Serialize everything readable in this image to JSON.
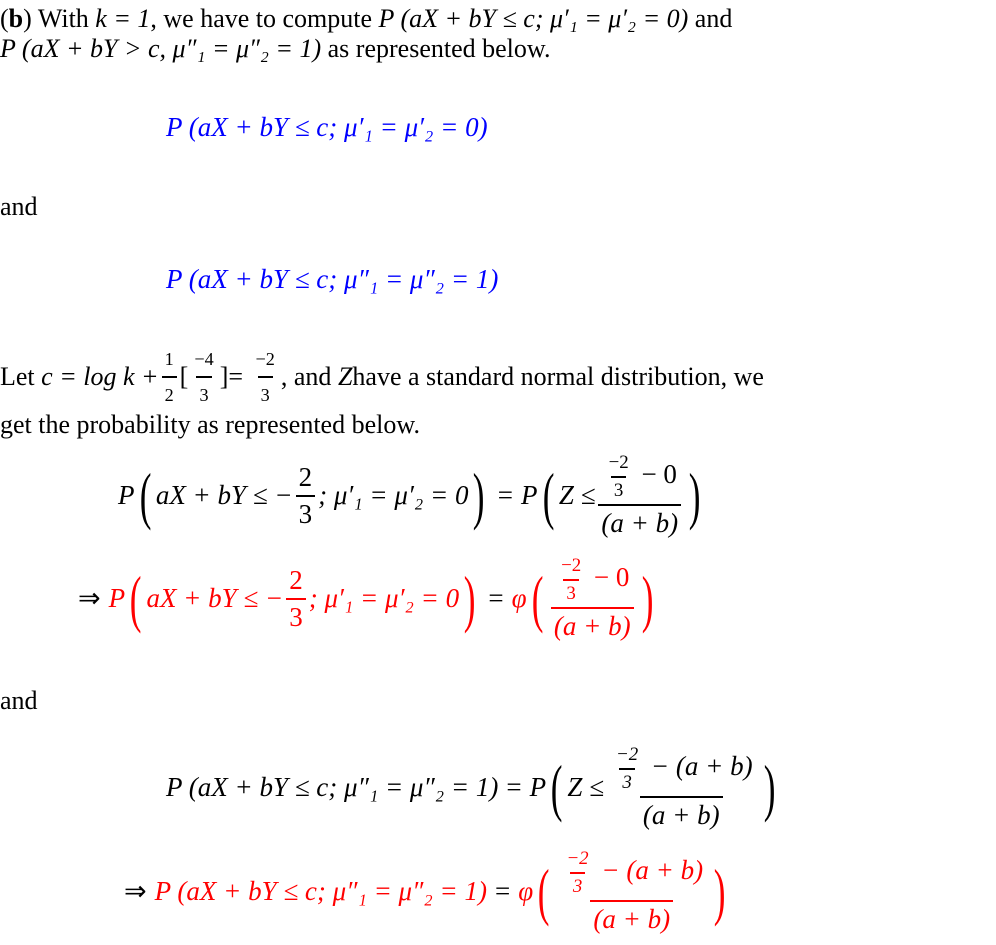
{
  "part_label": "b",
  "intro": {
    "line1_prefix": "With ",
    "k_eq": "k = 1",
    "line1_mid": ", we have to compute ",
    "expr1": "P (aX + bY ≤ c; μ′₁ = μ′₂ = 0)",
    "line1_suffix": " and",
    "expr2": "P (aX + bY > c, μ″₁ = μ″₂ = 1)",
    "line2_suffix": " as represented below."
  },
  "display1": {
    "text": "P (aX + bY ≤ c; μ′₁ = μ′₂ = 0)",
    "color": "#0000ff"
  },
  "and_1": "and",
  "display2": {
    "text": "P (aX + bY ≤ c; μ″₁ = μ″₂ = 1)",
    "color": "#0000ff"
  },
  "let_para": {
    "prefix": "Let ",
    "c_def": "c = log k + ",
    "half_num": "1",
    "half_den": "2",
    "bracket_num": "−4",
    "bracket_den": "3",
    "eq": " = ",
    "res_num": "−2",
    "res_den": "3",
    "suffix1": ", and ",
    "Z": "Z",
    "suffix2": " have a standard normal distribution, we",
    "line2": "get the probability as represented below."
  },
  "eq_block1": {
    "line1_lhs": "P",
    "line1_inner_a": "aX + bY ≤ −",
    "frac_num": "2",
    "frac_den": "3",
    "line1_inner_b": "; μ′₁ = μ′₂ = 0",
    "equals": "=",
    "rhs_P": "P",
    "rhs_Z": "Z ≤",
    "rhs_small_num": "−2",
    "rhs_small_den": "3",
    "rhs_num_rest": " − 0",
    "rhs_den": "(a + b)",
    "line2_arrow": "⇒",
    "line2_lhs": "P",
    "line2_phi": "φ",
    "color": "#ff0000"
  },
  "and_2": "and",
  "eq_block2": {
    "line1_lhs": "P (aX + bY ≤ c; μ″₁ = μ″₂ = 1)",
    "equals": "=",
    "rhs_P": "P",
    "rhs_Z": "Z ≤",
    "rhs_small_num": "−2",
    "rhs_small_den": "3",
    "rhs_num_rest": " − (a + b)",
    "rhs_den": "(a + b)",
    "line2_arrow": "⇒",
    "line2_lhs": "P (aX + bY ≤ c; μ″₁ = μ″₂ = 1)",
    "line2_phi": "φ",
    "color": "#ff0000"
  }
}
